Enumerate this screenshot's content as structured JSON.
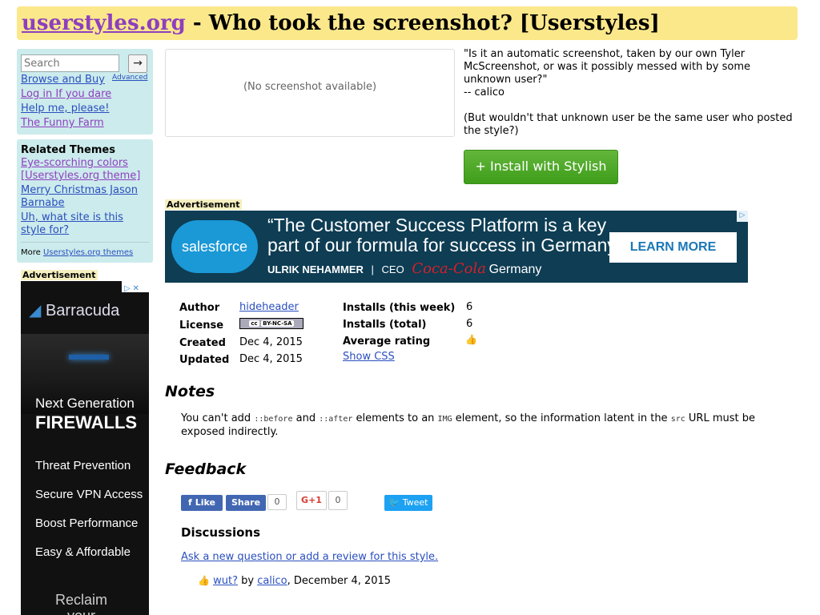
{
  "header": {
    "site": "userstyles.org",
    "rest": " - Who took the screenshot? [Userstyles]"
  },
  "sidebar": {
    "search_placeholder": "Search",
    "search_go": "→",
    "advanced": "Advanced",
    "nav": [
      "Browse and Buy",
      "Log in If you dare",
      "Help me, please!",
      "The Funny Farm"
    ],
    "related_title": "Related Themes",
    "themes": [
      "Eye-scorching colors [Userstyles.org theme]",
      "Merry Christmas Jason Barnabe",
      "Uh, what site is this style for?"
    ],
    "more_prefix": "More ",
    "more_link": "Userstyles.org themes"
  },
  "ads": {
    "label": "Advertisement",
    "left": {
      "brand": "Barracuda",
      "line1": "Next Generation",
      "line2": "FIREWALLS",
      "items": [
        "Threat Prevention",
        "Secure VPN Access",
        "Boost Performance",
        "Easy & Affordable"
      ],
      "footer1": "Reclaim",
      "footer2": "your"
    },
    "banner": {
      "logo": "salesforce",
      "quote1": "“The Customer Success Platform is a key",
      "quote2": "part of our formula for success in Germany.”",
      "person": "ULRIK NEHAMMER",
      "role": "CEO",
      "company": "Coca-Cola",
      "country": "Germany",
      "cta": "LEARN MORE"
    }
  },
  "screenshot": {
    "placeholder": "(No screenshot available)"
  },
  "description": {
    "quote": "\"Is it an automatic screenshot, taken by our own Tyler McScreenshot, or was it possibly messed with by some unknown user?\"",
    "attribution": "-- calico",
    "note": "(But wouldn't that unknown user be the same user who posted the style?)"
  },
  "install_button": "+ Install with Stylish",
  "info": {
    "author_label": "Author",
    "author": "hideheader",
    "license_label": "License",
    "license_badge": "BY-NC-SA",
    "created_label": "Created",
    "created": "Dec 4, 2015",
    "updated_label": "Updated",
    "updated": "Dec 4, 2015",
    "installs_week_label": "Installs (this week)",
    "installs_week": "6",
    "installs_total_label": "Installs (total)",
    "installs_total": "6",
    "rating_label": "Average rating",
    "show_css": "Show CSS"
  },
  "notes": {
    "title": "Notes",
    "t1": "You can't add ",
    "c1": "::before",
    "t2": " and ",
    "c2": "::after",
    "t3": " elements to an ",
    "c3": "IMG",
    "t4": " element, so the information latent in the ",
    "c4": "src",
    "t5": " URL must be exposed indirectly."
  },
  "feedback": {
    "title": "Feedback",
    "like": "Like",
    "share": "Share",
    "fb_count": "0",
    "gplus": "G+1",
    "gplus_count": "0",
    "tweet": "Tweet",
    "discussions_title": "Discussions",
    "ask": "Ask a new question or add a review for this style.",
    "disc_title": "wut?",
    "disc_by": " by ",
    "disc_author": "calico",
    "disc_date": ", December 4, 2015"
  }
}
